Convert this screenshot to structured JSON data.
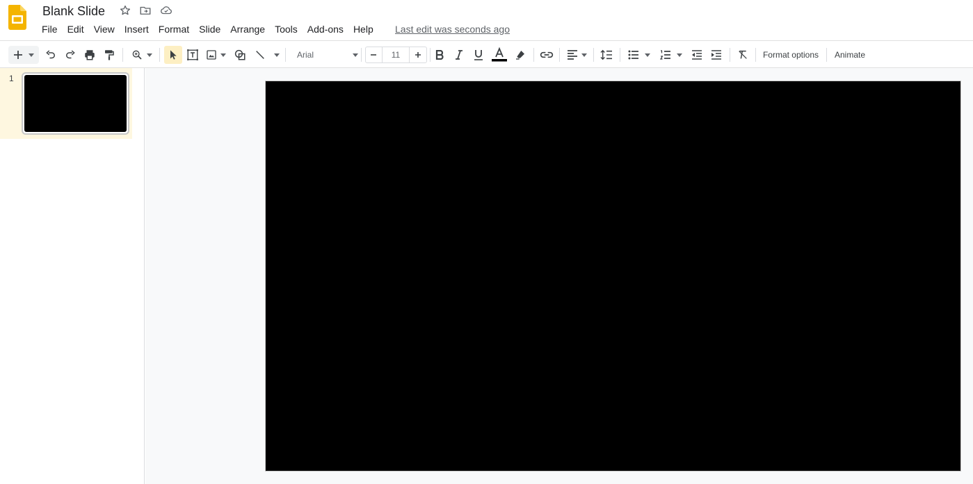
{
  "app": {
    "title": "Blank Slide",
    "logo_icon": "google-slides-logo",
    "brand_color": "#f4b400"
  },
  "menu": {
    "items": [
      "File",
      "Edit",
      "View",
      "Insert",
      "Format",
      "Slide",
      "Arrange",
      "Tools",
      "Add-ons",
      "Help"
    ],
    "last_edit": "Last edit was seconds ago"
  },
  "toolbar": {
    "font_name": "Arial",
    "font_size": "11",
    "format_options_label": "Format options",
    "animate_label": "Animate",
    "text_color_underline": "#000000",
    "icons": [
      "plus-icon",
      "undo-icon",
      "redo-icon",
      "print-icon",
      "paint-format-icon",
      "zoom-icon",
      "select-icon",
      "text-box-icon",
      "image-icon",
      "shape-icon",
      "line-icon",
      "bold-icon",
      "italic-icon",
      "underline-icon",
      "text-color-icon",
      "highlight-icon",
      "link-icon",
      "align-icon",
      "line-spacing-icon",
      "bulleted-list-icon",
      "numbered-list-icon",
      "decrease-indent-icon",
      "increase-indent-icon",
      "clear-formatting-icon"
    ]
  },
  "filmstrip": {
    "slides": [
      {
        "number": "1",
        "background": "#000000"
      }
    ]
  },
  "canvas": {
    "slide_background": "#000000"
  }
}
